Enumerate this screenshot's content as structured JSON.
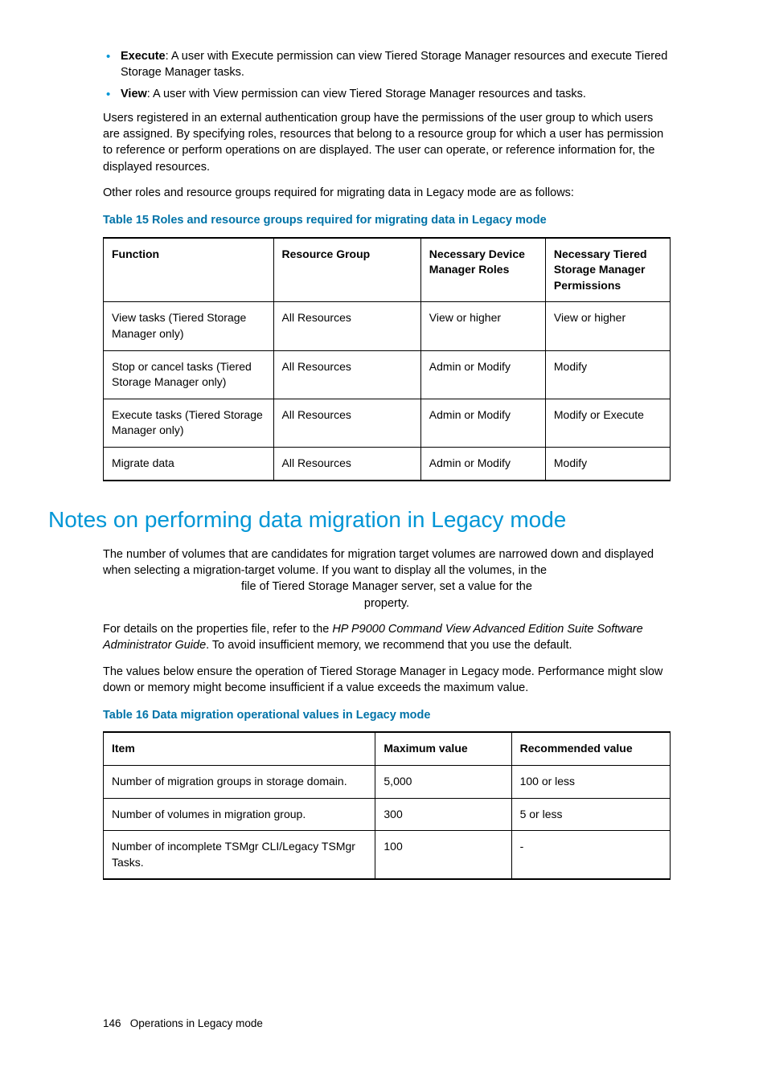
{
  "bullets": [
    {
      "term": "Execute",
      "text": ": A user with Execute permission can view Tiered Storage Manager resources and execute Tiered Storage Manager tasks."
    },
    {
      "term": "View",
      "text": ": A user with View permission can view Tiered Storage Manager resources and tasks."
    }
  ],
  "para1": "Users registered in an external authentication group have the permissions of the user group to which users are assigned. By specifying roles, resources that belong to a resource group for which a user has permission to reference or perform operations on are displayed. The user can operate, or reference information for, the displayed resources.",
  "para2": "Other roles and resource groups required for migrating data in Legacy mode are as follows:",
  "table15": {
    "caption": "Table 15 Roles and resource groups required for migrating data in Legacy mode",
    "headers": [
      "Function",
      "Resource Group",
      "Necessary Device Manager Roles",
      "Necessary Tiered Storage Manager Permissions"
    ],
    "rows": [
      [
        "View tasks (Tiered Storage Manager only)",
        "All Resources",
        "View or higher",
        "View or higher"
      ],
      [
        "Stop or cancel tasks (Tiered Storage Manager only)",
        "All Resources",
        "Admin or Modify",
        "Modify"
      ],
      [
        "Execute tasks (Tiered Storage Manager only)",
        "All Resources",
        "Admin or Modify",
        "Modify or Execute"
      ],
      [
        "Migrate data",
        "All Resources",
        "Admin or Modify",
        "Modify"
      ]
    ]
  },
  "heading": "Notes on performing data migration in Legacy mode",
  "para3a": "The number of volumes that are candidates for migration target volumes are narrowed down and displayed when selecting a migration-target volume. If you want to display all the volumes, in the",
  "para3b": "file of Tiered Storage Manager server, set a value for the",
  "para3c": "property.",
  "para4a": "For details on the properties file, refer to the ",
  "para4italic": "HP P9000 Command View Advanced Edition Suite Software Administrator Guide",
  "para4b": ". To avoid insufficient memory, we recommend that you use the default.",
  "para5": "The values below ensure the operation of Tiered Storage Manager in Legacy mode. Performance might slow down or memory might become insufficient if a value exceeds the maximum value.",
  "table16": {
    "caption": "Table 16 Data migration operational values in Legacy mode",
    "headers": [
      "Item",
      "Maximum value",
      "Recommended value"
    ],
    "rows": [
      [
        "Number of migration groups in storage domain.",
        "5,000",
        "100 or less"
      ],
      [
        "Number of volumes in migration group.",
        "300",
        "5 or less"
      ],
      [
        "Number of incomplete TSMgr CLI/Legacy TSMgr Tasks.",
        "100",
        "-"
      ]
    ]
  },
  "footer": {
    "page": "146",
    "section": "Operations in Legacy mode"
  }
}
